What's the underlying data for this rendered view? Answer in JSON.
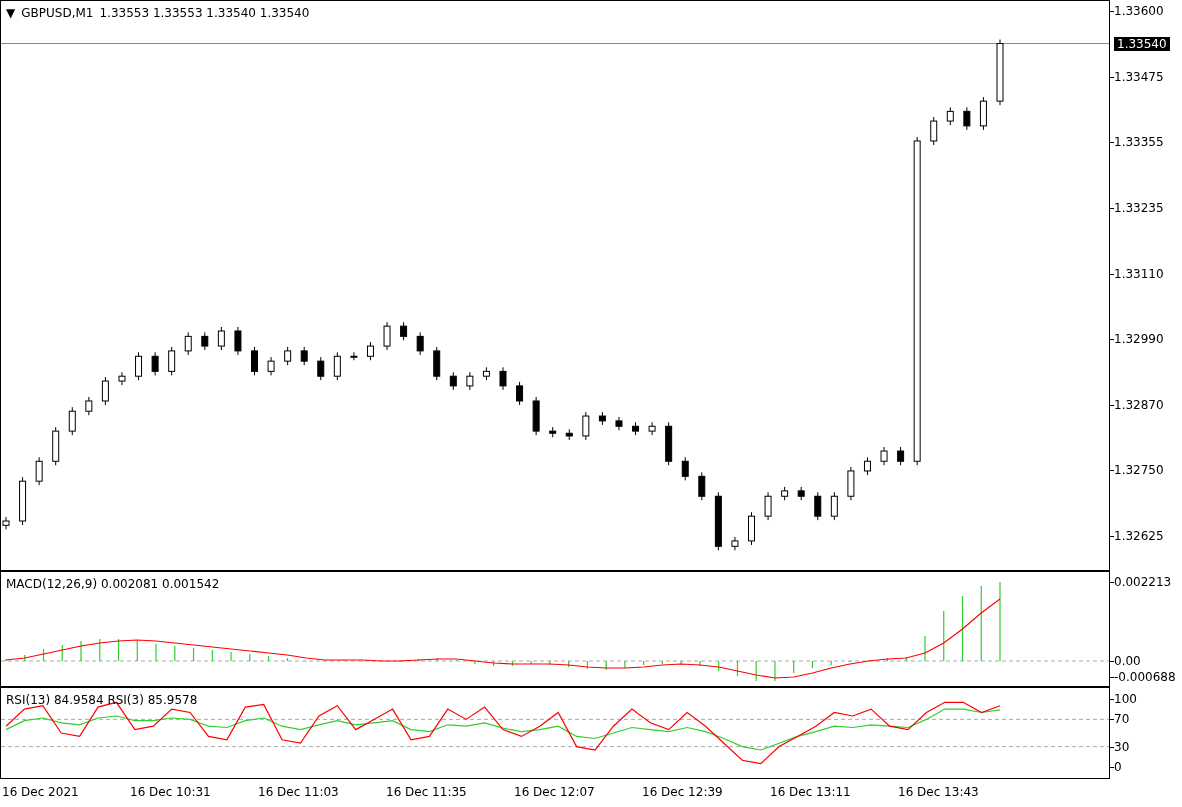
{
  "main_chart": {
    "toggle": "▼",
    "symbol": "GBPUSD,M1",
    "ohlc": "1.33553 1.33553 1.33540 1.33540",
    "current_price": "1.33540",
    "price_axis": [
      "1.33600",
      "1.33475",
      "1.33355",
      "1.33235",
      "1.33110",
      "1.32990",
      "1.32870",
      "1.32750",
      "1.32625"
    ]
  },
  "macd": {
    "label": "MACD(12,26,9) 0.002081 0.001542",
    "value_axis": [
      "0.002213",
      "0.00",
      "-0.000688"
    ]
  },
  "rsi": {
    "label": "RSI(13) 84.9584  RSI(3) 85.9578",
    "chart_data": {
      "type": "line",
      "ylim": [
        -16,
        116
      ],
      "yticks": [
        {
          "value": 100,
          "label": "100"
        },
        {
          "value": 70,
          "label": "70"
        },
        {
          "value": 30,
          "label": "30"
        },
        {
          "value": 0,
          "label": "0"
        }
      ],
      "series": [
        {
          "color": "#32cd32",
          "values": [
            55,
            68,
            72,
            65,
            62,
            72,
            75,
            68,
            68,
            72,
            70,
            60,
            58,
            68,
            72,
            60,
            55,
            62,
            68,
            62,
            65,
            68,
            55,
            52,
            62,
            60,
            65,
            57,
            52,
            55,
            60,
            45,
            42,
            50,
            58,
            55,
            52,
            58,
            52,
            42,
            30,
            25,
            35,
            45,
            52,
            60,
            58,
            62,
            60,
            58,
            70,
            85,
            85,
            80,
            84
          ]
        },
        {
          "color": "#ff0000",
          "values": [
            60,
            85,
            90,
            50,
            45,
            88,
            95,
            55,
            60,
            85,
            80,
            45,
            40,
            88,
            92,
            40,
            35,
            75,
            90,
            55,
            70,
            85,
            40,
            45,
            85,
            70,
            88,
            55,
            45,
            60,
            80,
            30,
            25,
            60,
            85,
            65,
            55,
            80,
            60,
            35,
            10,
            5,
            30,
            45,
            60,
            80,
            75,
            85,
            60,
            55,
            80,
            95,
            95,
            80,
            90
          ]
        }
      ]
    }
  },
  "time_axis": [
    "16 Dec 2021",
    "16 Dec 10:31",
    "16 Dec 11:03",
    "16 Dec 11:35",
    "16 Dec 12:07",
    "16 Dec 12:39",
    "16 Dec 13:11",
    "16 Dec 13:43"
  ]
}
